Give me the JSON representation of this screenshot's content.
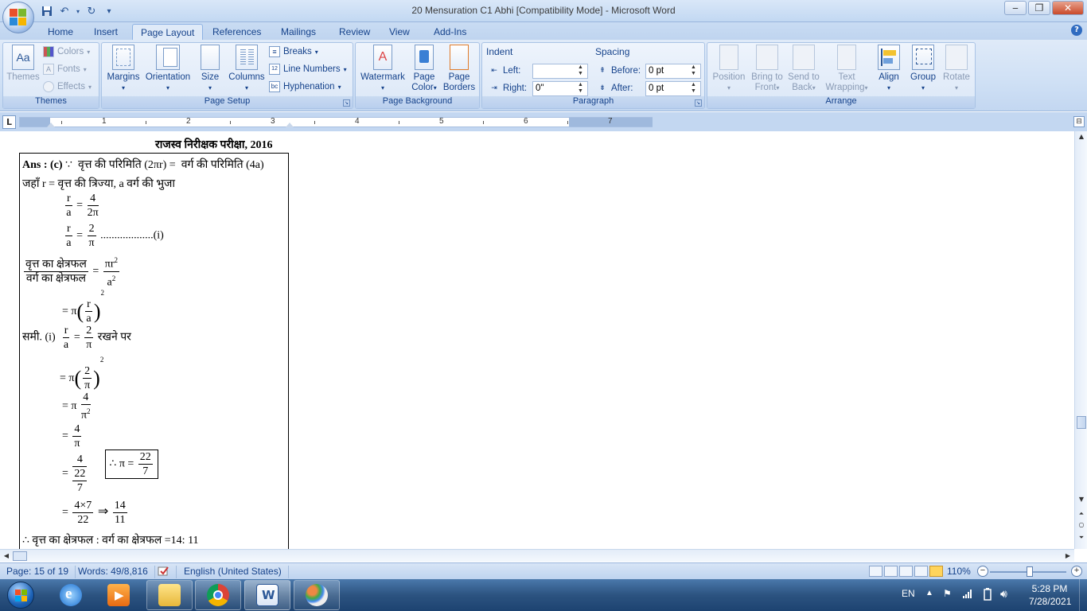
{
  "window": {
    "title": "20 Mensuration C1 Abhi [Compatibility Mode] - Microsoft Word"
  },
  "tabs": [
    "Home",
    "Insert",
    "Page Layout",
    "References",
    "Mailings",
    "Review",
    "View",
    "Add-Ins"
  ],
  "active_tab": "Page Layout",
  "ribbon": {
    "themes": {
      "label": "Themes",
      "themes_button": "Themes",
      "colors": "Colors",
      "fonts": "Fonts",
      "effects": "Effects"
    },
    "page_setup": {
      "label": "Page Setup",
      "margins": "Margins",
      "orientation": "Orientation",
      "size": "Size",
      "columns": "Columns",
      "breaks": "Breaks",
      "line_numbers": "Line Numbers",
      "hyphenation": "Hyphenation"
    },
    "page_background": {
      "label": "Page Background",
      "watermark": "Watermark",
      "page_color_1": "Page",
      "page_color_2": "Color",
      "page_borders_1": "Page",
      "page_borders_2": "Borders"
    },
    "paragraph": {
      "label": "Paragraph",
      "indent": "Indent",
      "left_label": "Left:",
      "left_value": "",
      "right_label": "Right:",
      "right_value": "0\"",
      "spacing": "Spacing",
      "before_label": "Before:",
      "before_value": "0 pt",
      "after_label": "After:",
      "after_value": "0 pt"
    },
    "arrange": {
      "label": "Arrange",
      "position": "Position",
      "bring_front_1": "Bring to",
      "bring_front_2": "Front",
      "send_back_1": "Send to",
      "send_back_2": "Back",
      "text_wrap_1": "Text",
      "text_wrap_2": "Wrapping",
      "align": "Align",
      "group": "Group",
      "rotate": "Rotate"
    }
  },
  "ruler": {
    "numbers": [
      "1",
      "2",
      "3",
      "4",
      "5",
      "6",
      "7"
    ],
    "tab_selector": "L"
  },
  "document": {
    "heading": "राजस्व निरीक्षक परीक्षा, 2016",
    "lines": {
      "ans": "Ans : (c)",
      "because": "∵",
      "circle_perimeter": "वृत्त की परिमिति",
      "paren_2pir": "(2πr)",
      "eq": "=",
      "square_perimeter": "वर्ग की परिमिति",
      "paren_4a": "(4a)",
      "where": "जहाँ r = वृत्त की त्रिज्या,  a वर्ग की भुजा",
      "r": "r",
      "a": "a",
      "four": "4",
      "two_pi": "2π",
      "two": "2",
      "pi": "π",
      "dots_i": "...................(i)",
      "circle_area": "वृत्त का क्षेत्रफल",
      "square_area": "वर्ग का क्षेत्रफल",
      "pi_r": "πr",
      "sq": "2",
      "a_sym": "a",
      "eq_pi": "= π",
      "sami": "समी. (i)",
      "putting": "रखने पर",
      "pi_sq": "π",
      "therefore": "∴ π =",
      "twenty_two": "22",
      "seven": "7",
      "four_x_seven": "4×7",
      "implies": "⇒",
      "fourteen": "14",
      "eleven": "11",
      "conclusion": "∴ वृत्त का क्षेत्रफल : वर्ग का क्षेत्रफल  =14: 11"
    }
  },
  "status": {
    "page": "Page: 15 of 19",
    "words": "Words: 49/8,816",
    "language": "English (United States)",
    "zoom": "110%"
  },
  "taskbar": {
    "lang": "EN",
    "time": "5:28 PM",
    "date": "7/28/2021"
  },
  "colors": {
    "ribbon_text": "#15428b",
    "ribbon_bg": "#dfeaf8",
    "taskbar": "#2c5380"
  }
}
